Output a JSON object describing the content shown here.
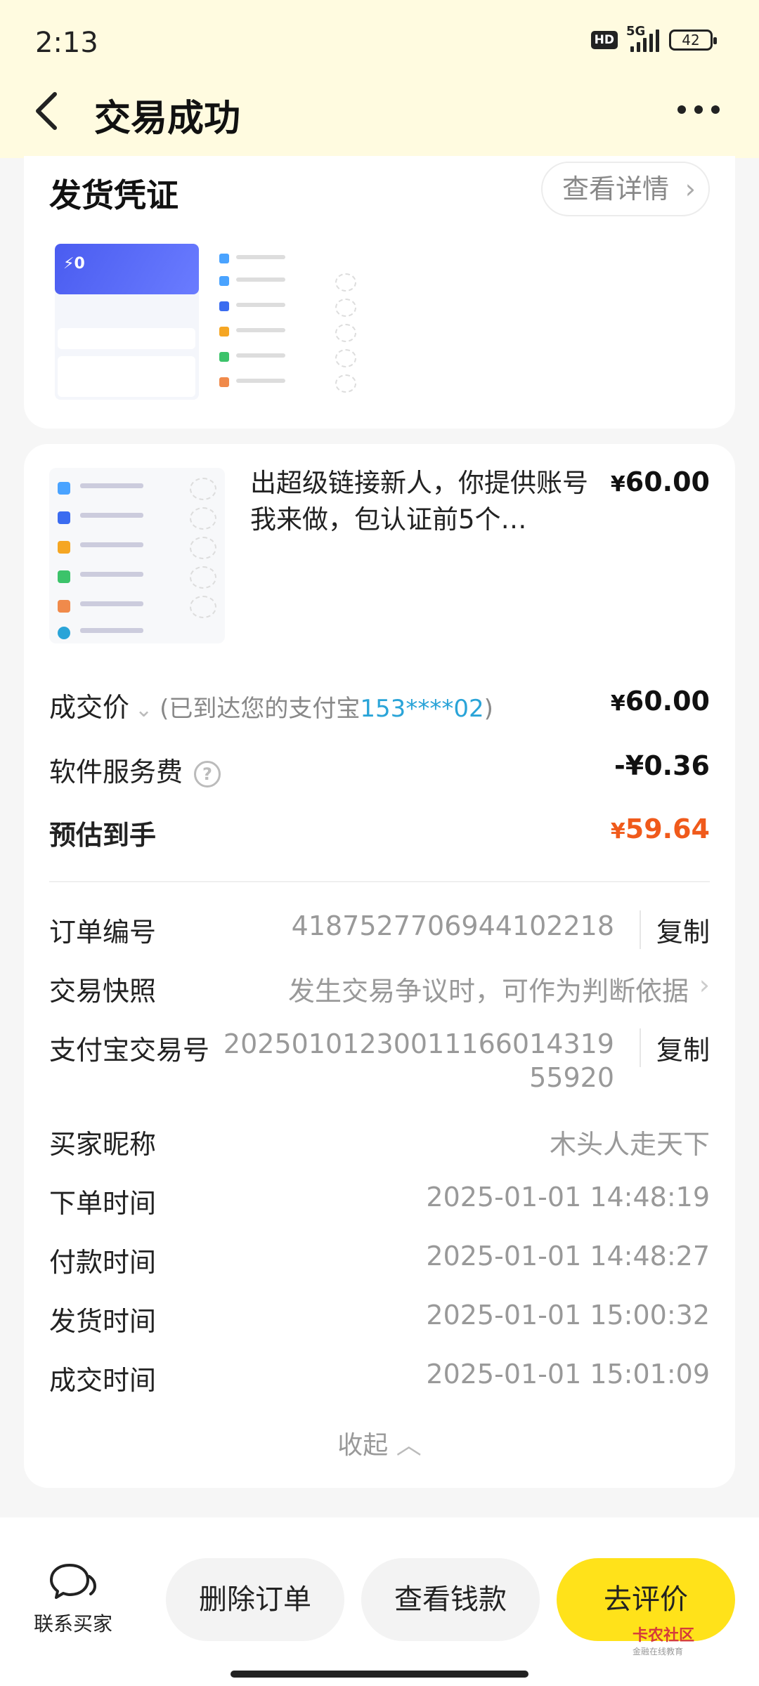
{
  "status_bar": {
    "time": "2:13",
    "hd": "HD",
    "network": "5G",
    "battery": "42"
  },
  "nav": {
    "title": "交易成功"
  },
  "voucher": {
    "title": "发货凭证",
    "detail_button": "查看详情"
  },
  "product": {
    "title": "出超级链接新人，你提供账号我来做，包认证前5个…",
    "price": "60.00",
    "currency": "¥"
  },
  "summary": {
    "deal_price_label": "成交价",
    "deal_note_prefix": "(已到达您的支付宝",
    "deal_note_phone": "153****02",
    "deal_note_suffix": ")",
    "deal_price": "60.00",
    "fee_label": "软件服务费",
    "fee_value": "-¥0.36",
    "estimate_label": "预估到手",
    "estimate_value": "59.64"
  },
  "details": {
    "order_no_label": "订单编号",
    "order_no": "4187527706944102218",
    "copy": "复制",
    "snapshot_label": "交易快照",
    "snapshot_value": "发生交易争议时，可作为判断依据",
    "alipay_label": "支付宝交易号",
    "alipay_line1": "20250101230011166014319",
    "alipay_line2": "55920",
    "buyer_label": "买家昵称",
    "buyer_value": "木头人走天下",
    "order_time_label": "下单时间",
    "order_time": "2025-01-01 14:48:19",
    "pay_time_label": "付款时间",
    "pay_time": "2025-01-01 14:48:27",
    "ship_time_label": "发货时间",
    "ship_time": "2025-01-01 15:00:32",
    "deal_time_label": "成交时间",
    "deal_time": "2025-01-01 15:01:09",
    "collapse": "收起"
  },
  "bottom": {
    "contact": "联系买家",
    "delete": "删除订单",
    "view_money": "查看钱款",
    "rate": "去评价"
  },
  "watermark": {
    "text": "卡农社区",
    "sub": "金融在线教育"
  }
}
